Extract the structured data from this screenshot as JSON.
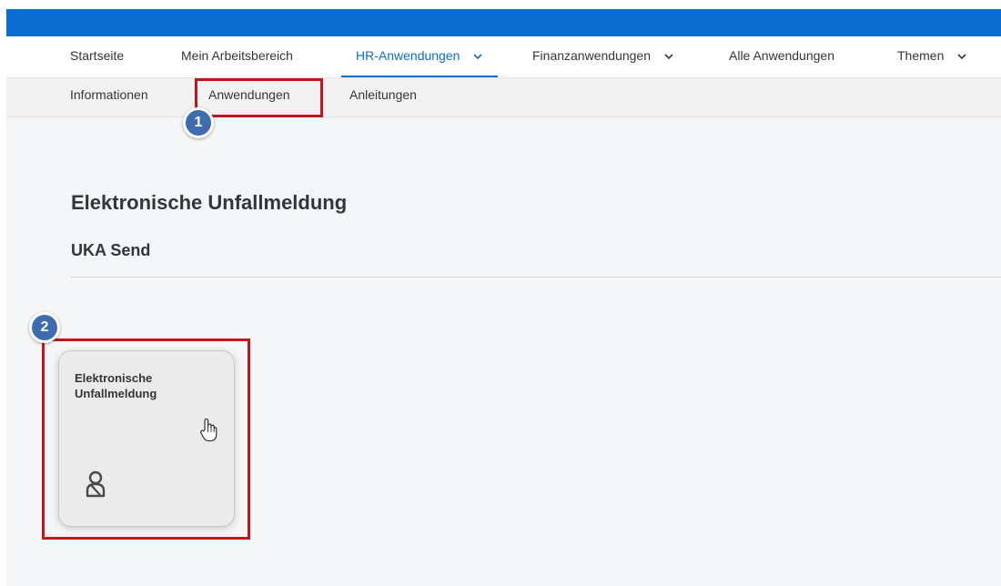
{
  "topnav": {
    "items": [
      {
        "label": "Startseite"
      },
      {
        "label": "Mein Arbeitsbereich"
      },
      {
        "label": "HR-Anwendungen"
      },
      {
        "label": "Finanzanwendungen"
      },
      {
        "label": "Alle Anwendungen"
      },
      {
        "label": "Themen"
      }
    ],
    "active": "HR-Anwendungen"
  },
  "subnav": {
    "items": [
      {
        "label": "Informationen"
      },
      {
        "label": "Anwendungen"
      },
      {
        "label": "Anleitungen"
      }
    ]
  },
  "annotations": {
    "badge1": "1",
    "badge2": "2",
    "highlight_color": "#c0161c",
    "badge_color": "#3f6cae"
  },
  "section": {
    "title": "Elektronische Unfallmeldung",
    "group_title": "UKA Send"
  },
  "tile": {
    "title": "Elektronische Unfallmeldung",
    "icon": "person-icon"
  },
  "colors": {
    "shellbar": "#0a6ed1",
    "active_tab": "#0a6ed1",
    "background": "#f5f6f7"
  }
}
